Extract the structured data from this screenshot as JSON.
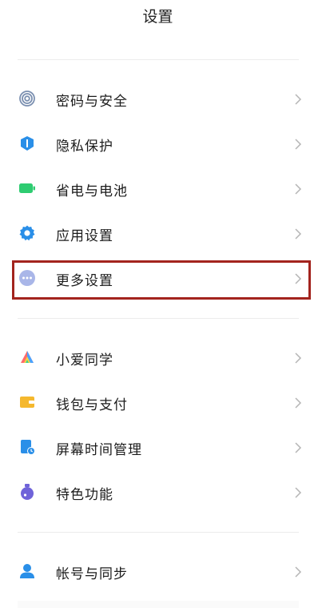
{
  "header": {
    "title": "设置"
  },
  "colors": {
    "highlight_border": "#a3241e",
    "chevron": "#b5b5b5"
  },
  "groups": [
    {
      "items": [
        {
          "label": "密码与安全",
          "icon": "fingerprint-icon",
          "color": "#7a8fb0"
        },
        {
          "label": "隐私保护",
          "icon": "privacy-shield-icon",
          "color": "#2a8fe8"
        },
        {
          "label": "省电与电池",
          "icon": "battery-icon",
          "color": "#2ecc71"
        },
        {
          "label": "应用设置",
          "icon": "gear-icon",
          "color": "#2a8fe8"
        },
        {
          "label": "更多设置",
          "icon": "more-dots-icon",
          "color": "#a9b6e8",
          "highlighted": true
        }
      ]
    },
    {
      "items": [
        {
          "label": "小爱同学",
          "icon": "xiaoai-icon",
          "color": "#ff6b6b"
        },
        {
          "label": "钱包与支付",
          "icon": "wallet-icon",
          "color": "#f5b82e"
        },
        {
          "label": "屏幕时间管理",
          "icon": "screen-time-icon",
          "color": "#2a8fe8"
        },
        {
          "label": "特色功能",
          "icon": "features-icon",
          "color": "#6f63d9"
        }
      ]
    },
    {
      "items": [
        {
          "label": "帐号与同步",
          "icon": "account-icon",
          "color": "#2a8fe8"
        }
      ]
    }
  ]
}
